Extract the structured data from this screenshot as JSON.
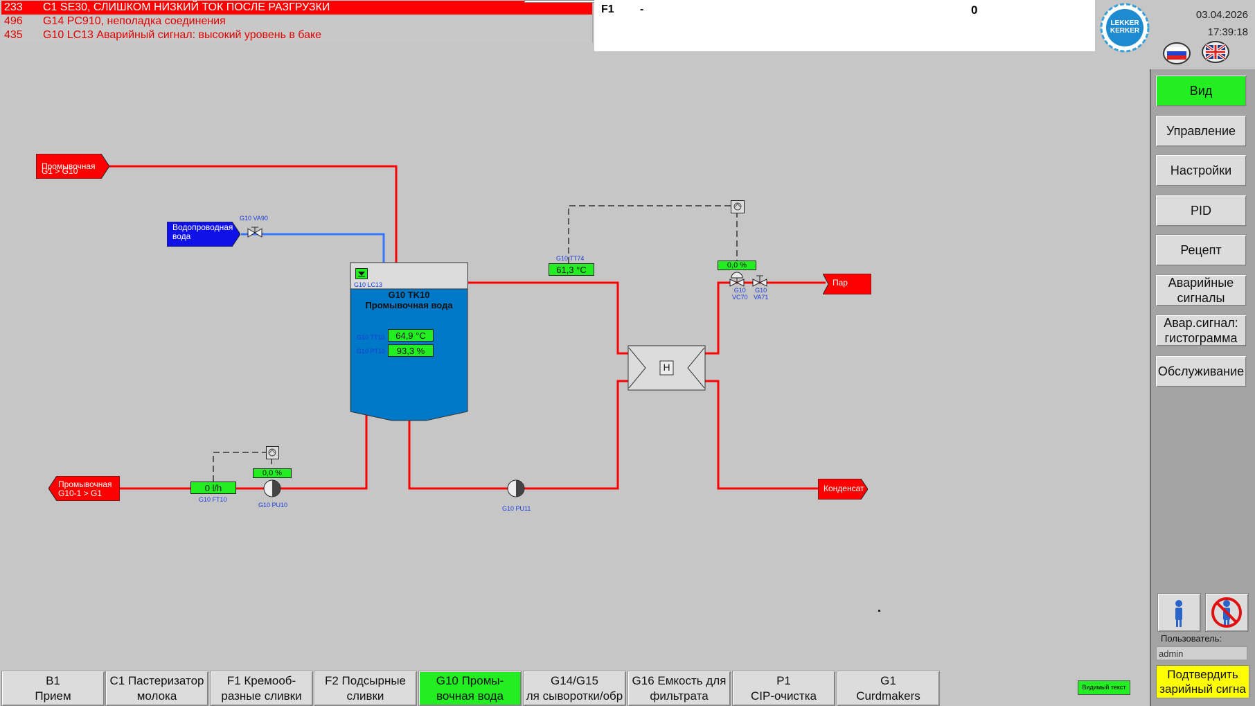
{
  "alarms": [
    {
      "num": "233",
      "text": "C1 SE30, СЛИШКОМ НИЗКИЙ ТОК ПОСЛЕ РАЗГРУЗКИ"
    },
    {
      "num": "496",
      "text": "G14 PC910, неполадка соединения"
    },
    {
      "num": "435",
      "text": "G10 LC13 Аварийный сигнал: высокий уровень в баке"
    }
  ],
  "message": {
    "code": "F1",
    "dash": "-",
    "value": "0"
  },
  "header": {
    "date": "03.04.2026",
    "time": "17:39:18",
    "logo_top": "LEKKER",
    "logo_bottom": "KERKER"
  },
  "menu": {
    "vid": "Вид",
    "upravlenie": "Управление",
    "nastroiki": "Настройки",
    "pid": "PID",
    "recept": "Рецепт",
    "alarms_line1": "Аварийные",
    "alarms_line2": "сигналы",
    "histo_line1": "Авар.сигнал:",
    "histo_line2": "гистограмма",
    "service": "Обслуживание"
  },
  "user": {
    "label": "Пользователь:",
    "name": "admin",
    "ack_line1": "Подтвердить",
    "ack_line2": "зарийный сигна"
  },
  "visible_text": "Видимый текст",
  "nav": [
    {
      "l1": "B1",
      "l2": "Прием",
      "active": false
    },
    {
      "l1": "C1 Пастеризатор",
      "l2": "молока",
      "active": false
    },
    {
      "l1": "F1 Кремооб-",
      "l2": "разные сливки",
      "active": false
    },
    {
      "l1": "F2 Подсырные",
      "l2": "сливки",
      "active": false
    },
    {
      "l1": "G10 Промы-",
      "l2": "вочная вода",
      "active": true
    },
    {
      "l1": "G14/G15",
      "l2": "ля сыворотки/обр",
      "active": false
    },
    {
      "l1": "G16 Емкость для",
      "l2": "фильтрата",
      "active": false
    },
    {
      "l1": "P1",
      "l2": "CIP-очистка",
      "active": false
    },
    {
      "l1": "G1",
      "l2": "Curdmakers",
      "active": false
    }
  ],
  "process": {
    "tag_g1_l1": "Промывочная",
    "tag_g1_l2": "G1 > G10",
    "tag_water_l1": "Водопроводная",
    "tag_water_l2": "вода",
    "tag_g10_l1": "Промывочная",
    "tag_g10_l2": "G10-1 > G1",
    "tag_steam": "Пар",
    "tag_condensate": "Конденсат",
    "tank_title": "G10 TK10",
    "tank_sub": "Промывочная вода",
    "lc13": "G10 LC13",
    "tt10_label": "G10 TT10",
    "tt10_value": "64,9 °C",
    "lt10_label": "G10 PT10",
    "lt10_value": "93,3 %",
    "va90": "G10 VA90",
    "tt74_label": "G10 TT74",
    "tt74_value": "61,3 °C",
    "vc70_pos": "0,0 %",
    "vc70_l1": "G10",
    "vc70_l2": "VC70",
    "va71_l1": "G10",
    "va71_l2": "VA71",
    "hx": "H",
    "ft10_value": "0 l/h",
    "ft10_label": "G10 FT10",
    "pu10_pos": "0,0 %",
    "pu10_label": "G10 PU10",
    "pu11_label": "G10 PU11"
  },
  "colors": {
    "product_line": "#ff0000",
    "water_line": "#3377ff",
    "tank_fill": "#0078c8",
    "value_bg": "#22ee22",
    "active_btn": "#22ee22",
    "alarm": "#ff0000"
  }
}
